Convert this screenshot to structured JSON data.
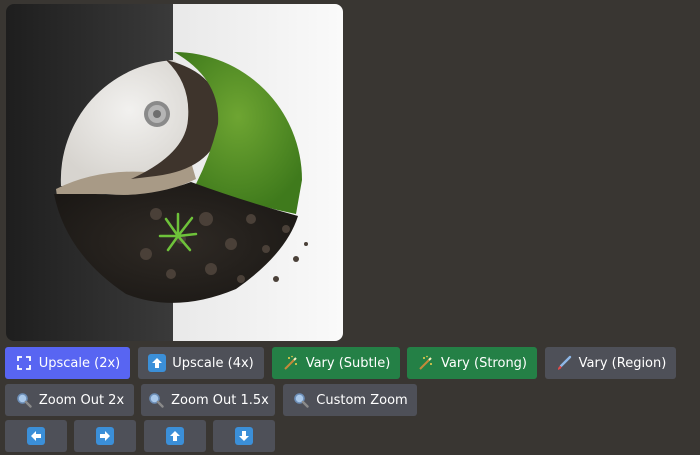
{
  "image": {
    "alt": "",
    "icon": "yin-yang-soil-grass-image"
  },
  "buttons_row1": [
    {
      "label": "Upscale (2x)",
      "icon": "expand-arrows-icon",
      "style": "primary"
    },
    {
      "label": "Upscale (4x)",
      "icon": "up-arrow-box-icon",
      "style": "secondary"
    },
    {
      "label": "Vary (Subtle)",
      "icon": "magic-wand-icon",
      "style": "success"
    },
    {
      "label": "Vary (Strong)",
      "icon": "magic-wand-icon",
      "style": "success"
    },
    {
      "label": "Vary (Region)",
      "icon": "paintbrush-icon",
      "style": "secondary"
    }
  ],
  "buttons_row2": [
    {
      "label": "Zoom Out 2x",
      "icon": "magnifier-icon"
    },
    {
      "label": "Zoom Out 1.5x",
      "icon": "magnifier-icon"
    },
    {
      "label": "Custom Zoom",
      "icon": "magnifier-icon"
    }
  ],
  "buttons_row3": [
    {
      "icon": "arrow-left-icon",
      "direction": "left"
    },
    {
      "icon": "arrow-right-icon",
      "direction": "right"
    },
    {
      "icon": "arrow-up-icon",
      "direction": "up"
    },
    {
      "icon": "arrow-down-icon",
      "direction": "down"
    }
  ],
  "colors": {
    "background": "#393632",
    "primary": "#5865f2",
    "success": "#248046",
    "secondary": "#4e5058",
    "arrow_icon": "#3b8fd8"
  }
}
